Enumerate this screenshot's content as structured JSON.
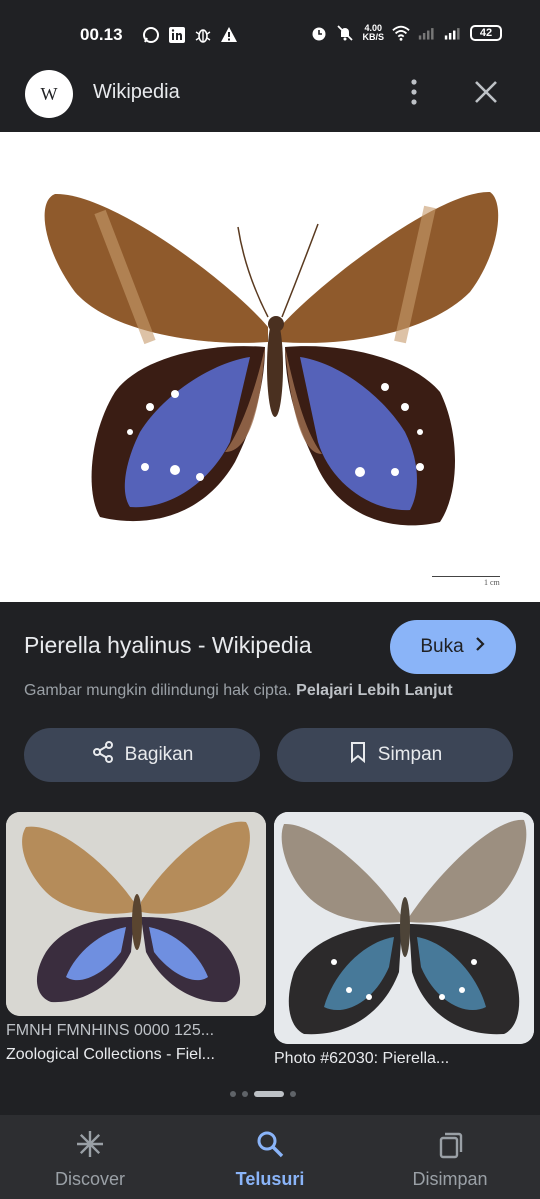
{
  "status_bar": {
    "time": "00.13",
    "net_speed_value": "4.00",
    "net_speed_unit": "KB/S",
    "battery": "42"
  },
  "app_bar": {
    "logo_letter": "W",
    "title": "Wikipedia"
  },
  "image": {
    "scale_label": "1 cm"
  },
  "result": {
    "title": "Pierella hyalinus - Wikipedia",
    "open_label": "Buka",
    "notice_text": "Gambar mungkin dilindungi hak cipta.",
    "notice_link": "Pelajari Lebih Lanjut"
  },
  "actions": {
    "share_label": "Bagikan",
    "save_label": "Simpan"
  },
  "related": [
    {
      "caption_line1": "FMNH FMNHINS 0000 125...",
      "caption_line2": "Zoological Collections - Fiel..."
    },
    {
      "caption_line1": "Photo #62030: Pierella..."
    }
  ],
  "bottom_nav": [
    {
      "label": "Discover",
      "icon": "asterisk-icon"
    },
    {
      "label": "Telusuri",
      "icon": "search-icon",
      "active": true
    },
    {
      "label": "Disimpan",
      "icon": "collections-icon"
    }
  ],
  "colors": {
    "accent": "#8ab4f8",
    "background": "#202124",
    "button_bg": "#3c4556"
  }
}
